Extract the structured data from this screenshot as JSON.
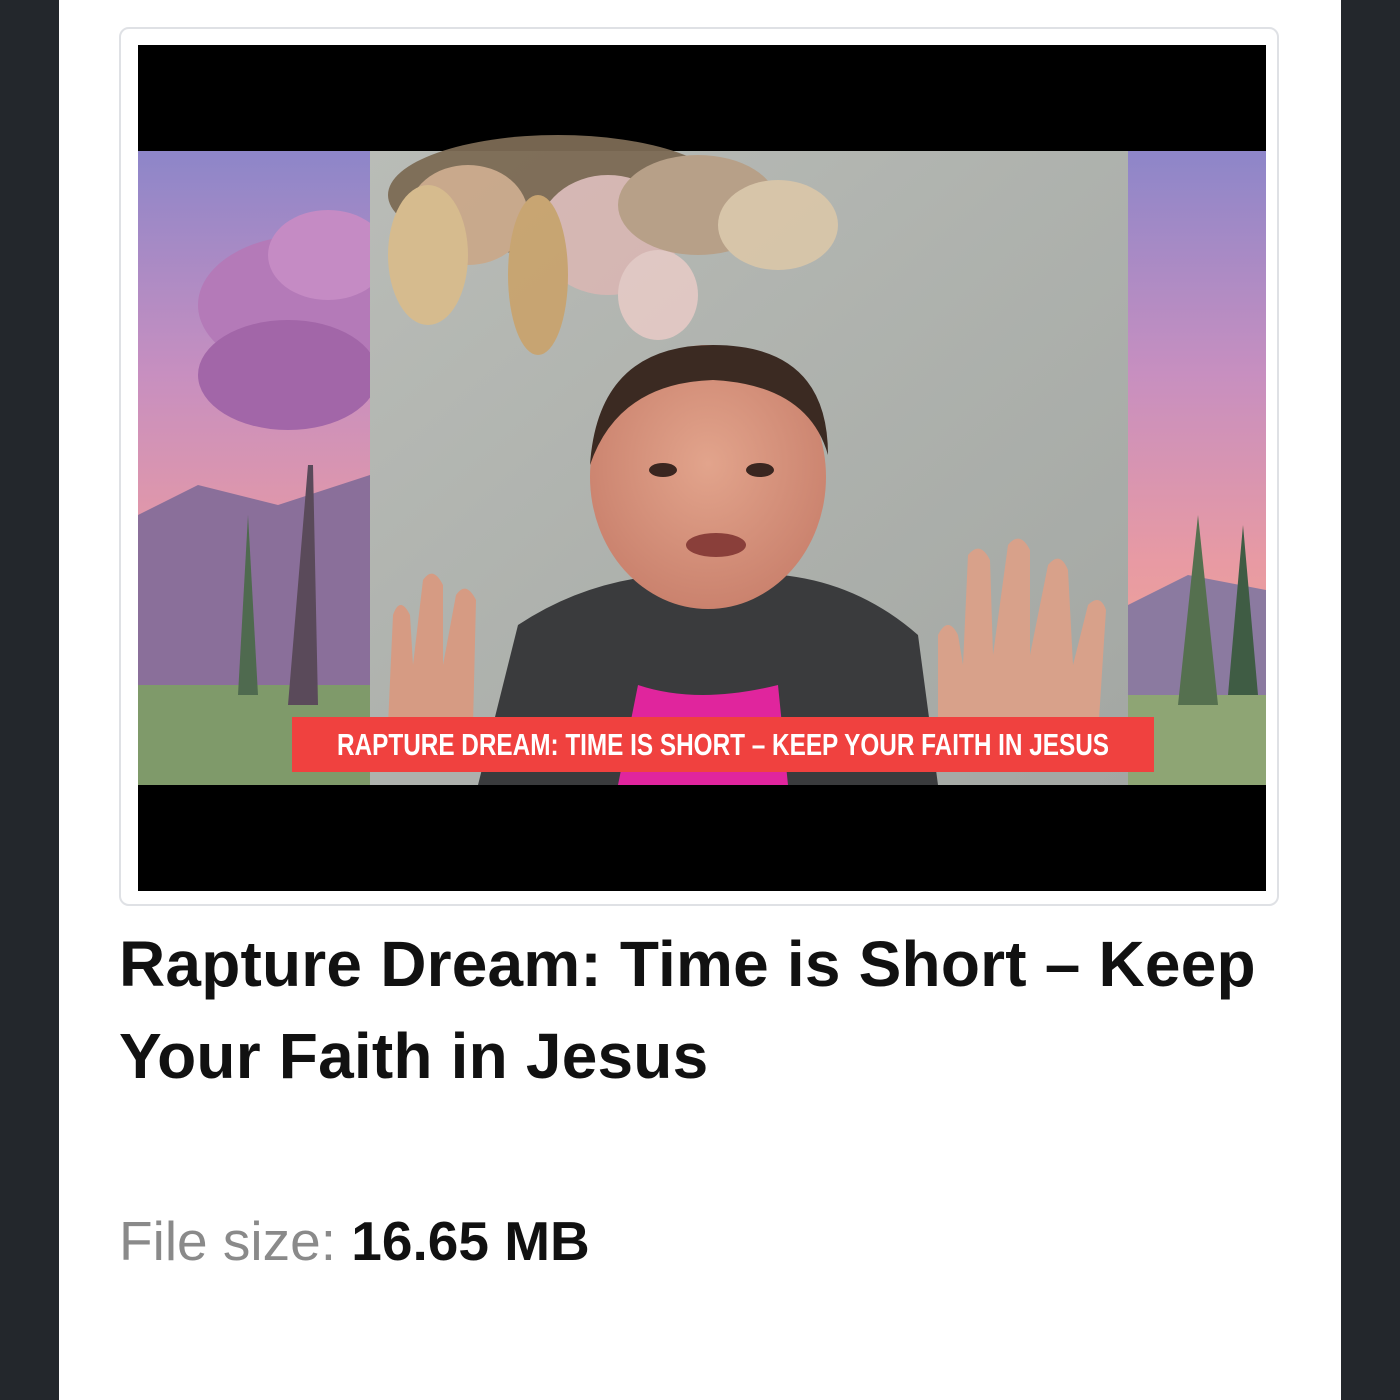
{
  "video": {
    "thumbnail_caption": "RAPTURE DREAM: TIME IS SHORT – KEEP YOUR FAITH IN JESUS"
  },
  "title": "Rapture Dream: Time is Short – Keep Your Faith in Jesus",
  "file": {
    "size_label": "File size:",
    "size_value": "16.65 MB"
  },
  "colors": {
    "caption_banner": "#f0413f",
    "page_bg": "#23272c",
    "card_bg": "#ffffff"
  }
}
